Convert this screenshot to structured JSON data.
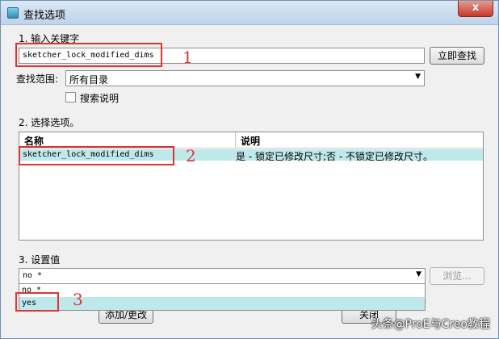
{
  "window": {
    "title": "查找选项",
    "close": "x"
  },
  "step1": {
    "label": "1.  输入关键字",
    "keyword": "sketcher_lock_modified_dims",
    "search_button": "立即查找"
  },
  "scope": {
    "label": "查找范围:",
    "value": "所有目录"
  },
  "search_desc": {
    "label": "搜索说明",
    "checked": false
  },
  "step2": {
    "label": "2.  选择选项。"
  },
  "table": {
    "headers": [
      "名称",
      "说明"
    ],
    "rows": [
      {
        "name": "sketcher_lock_modified_dims",
        "desc": "是 - 锁定已修改尺寸;否 - 不锁定已修改尺寸。"
      }
    ]
  },
  "step3": {
    "label": "3.  设置值",
    "value": "no *",
    "browse_button": "浏览...",
    "options": [
      "no *",
      "yes"
    ]
  },
  "buttons": {
    "add_change": "添加/更改",
    "close": "关闭"
  },
  "annotations": [
    "1",
    "2",
    "3"
  ],
  "watermark": "头条@ProE与Creo教程",
  "colors": {
    "highlight": "#bfe8ea",
    "annotation": "#e03434"
  }
}
